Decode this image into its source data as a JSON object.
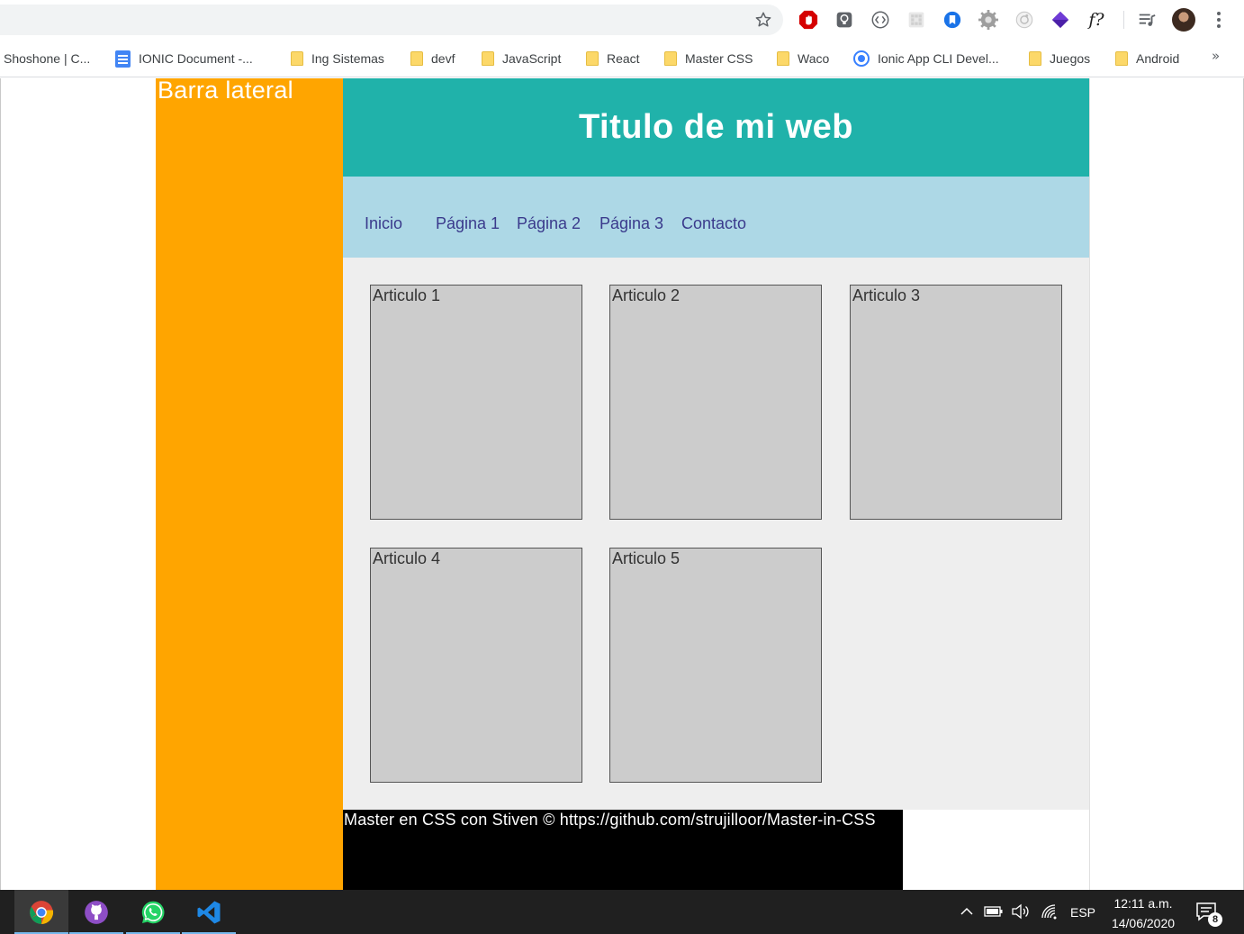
{
  "bookmarks": [
    {
      "label": "Shoshone | C...",
      "icon": "none"
    },
    {
      "label": "IONIC Document -...",
      "icon": "docs-icon"
    },
    {
      "label": "Ing Sistemas",
      "icon": "folder-icon"
    },
    {
      "label": "devf",
      "icon": "folder-icon"
    },
    {
      "label": "JavaScript",
      "icon": "folder-icon"
    },
    {
      "label": "React",
      "icon": "folder-icon"
    },
    {
      "label": "Master CSS",
      "icon": "folder-icon"
    },
    {
      "label": "Waco",
      "icon": "folder-icon"
    },
    {
      "label": "Ionic App CLI Devel...",
      "icon": "ionic-icon"
    },
    {
      "label": "Juegos",
      "icon": "folder-icon"
    },
    {
      "label": "Android",
      "icon": "folder-icon"
    }
  ],
  "bookmarks_more": "»",
  "extensions": {
    "fquery_label": "f?"
  },
  "page": {
    "sidebar_title": "Barra lateral",
    "site_title": "Titulo de mi web",
    "nav": [
      "Inicio",
      "Página 1",
      "Página 2",
      "Página 3",
      "Contacto"
    ],
    "articles": [
      "Articulo 1",
      "Articulo 2",
      "Articulo 3",
      "Articulo 4",
      "Articulo 5"
    ],
    "footer": "Master en CSS con Stiven © https://github.com/strujilloor/Master-in-CSS"
  },
  "colors": {
    "sidebar": "#ffa500",
    "header": "#20b2aa",
    "nav": "#add8e6",
    "content": "#eeeeee",
    "article": "#cccccc",
    "footer": "#000000"
  },
  "taskbar": {
    "apps": [
      "chrome-icon",
      "github-desktop-icon",
      "whatsapp-icon",
      "vscode-icon"
    ],
    "language": "ESP",
    "time": "12:11 a.m.",
    "date": "14/06/2020",
    "notifications": "8"
  }
}
